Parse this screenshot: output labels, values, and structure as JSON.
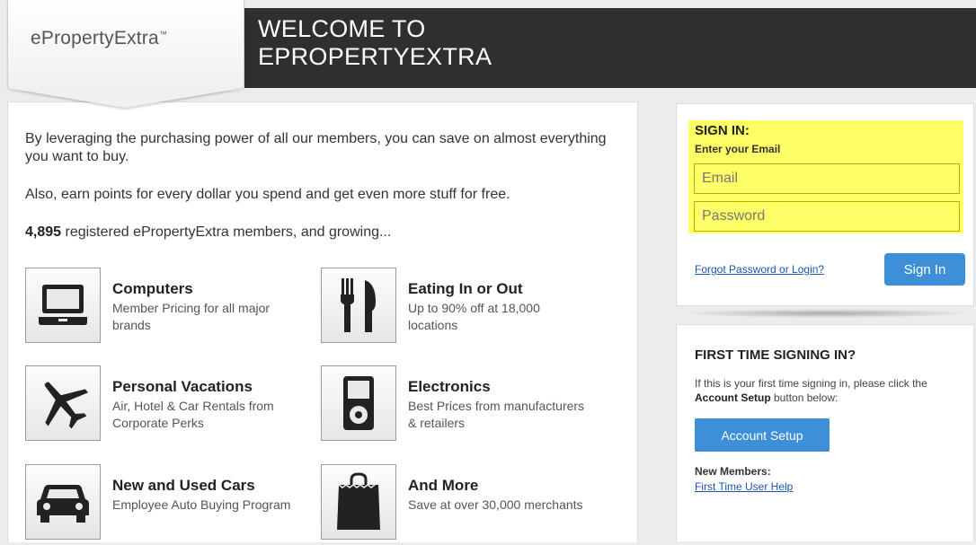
{
  "header": {
    "logo_text": "ePropertyExtra",
    "logo_tm": "™",
    "welcome_line1": "WELCOME TO",
    "welcome_line2": "EPROPERTYEXTRA"
  },
  "main": {
    "intro": "By leveraging the purchasing power of all our members, you can save on almost everything you want to buy.",
    "points_text": "Also, earn points for every dollar you spend and get even more stuff for free.",
    "member_count": "4,895",
    "member_text": " registered ePropertyExtra members, and growing...",
    "features": [
      {
        "title": "Computers",
        "desc": "Member Pricing for all major brands",
        "icon": "laptop-icon"
      },
      {
        "title": "Eating In or Out",
        "desc": "Up to 90% off at 18,000 locations",
        "icon": "fork-knife-icon"
      },
      {
        "title": "Personal Vacations",
        "desc": "Air, Hotel & Car Rentals from Corporate Perks",
        "icon": "airplane-icon"
      },
      {
        "title": "Electronics",
        "desc": "Best Prices from manufacturers & retailers",
        "icon": "media-player-icon"
      },
      {
        "title": "New and Used Cars",
        "desc": "Employee Auto Buying Program",
        "icon": "car-icon"
      },
      {
        "title": "And More",
        "desc": "Save at over 30,000 merchants",
        "icon": "shopping-bag-icon"
      }
    ]
  },
  "signin": {
    "title": "SIGN IN:",
    "subtitle": "Enter your Email",
    "email_placeholder": "Email",
    "password_placeholder": "Password",
    "forgot_link": "Forgot Password or Login?",
    "button_label": "Sign In",
    "highlight_color": "#ffff66"
  },
  "first_time": {
    "title": "FIRST TIME SIGNING IN?",
    "text_before": "If this is your first time signing in, please click the ",
    "text_bold": "Account Setup",
    "text_after": " button below:",
    "button_label": "Account Setup",
    "new_members_label": "New Members:",
    "help_link": "First Time User Help"
  },
  "colors": {
    "accent_blue": "#3d8fd8",
    "header_dark": "#2f2f2f",
    "link_blue": "#1a55b0"
  }
}
